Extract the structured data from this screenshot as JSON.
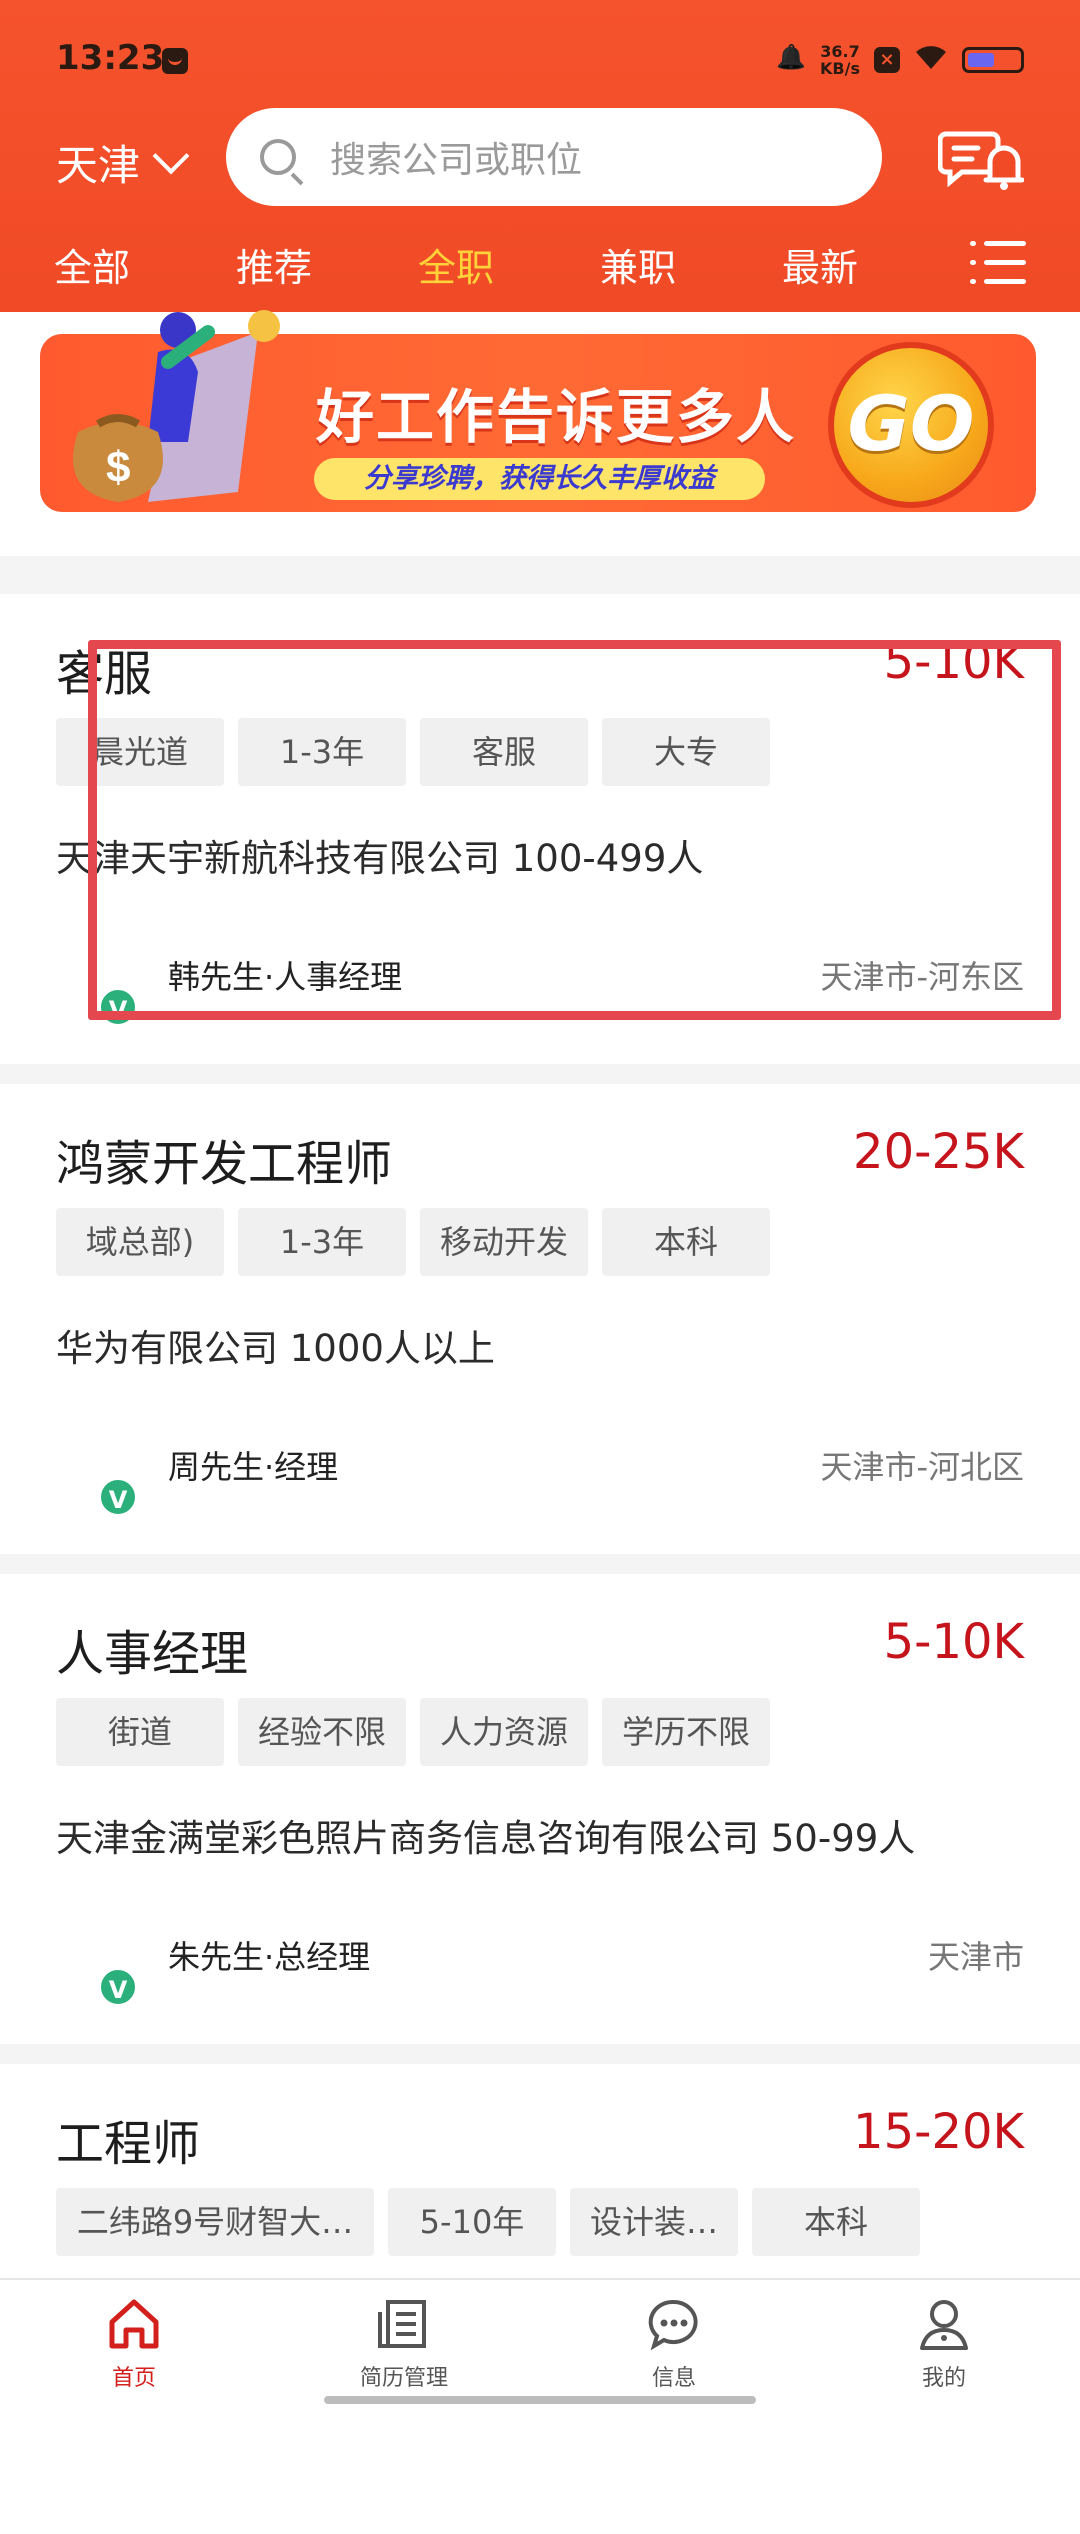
{
  "status": {
    "time": "13:23",
    "speed_value": "36.7",
    "speed_unit": "KB/s"
  },
  "header": {
    "city": "天津",
    "search_placeholder": "搜索公司或职位"
  },
  "tabs": [
    {
      "label": "全部",
      "active": false
    },
    {
      "label": "推荐",
      "active": false
    },
    {
      "label": "全职",
      "active": true
    },
    {
      "label": "兼职",
      "active": false
    },
    {
      "label": "最新",
      "active": false
    }
  ],
  "banner": {
    "title": "好工作告诉更多人",
    "subtitle": "分享珍聘，获得长久丰厚收益",
    "go": "GO"
  },
  "jobs": [
    {
      "title": "客服",
      "salary": "5-10K",
      "tags": [
        "晨光道",
        "1-3年",
        "客服",
        "大专"
      ],
      "company": "天津天宇新航科技有限公司  100-499人",
      "recruiter": "韩先生·人事经理",
      "location": "天津市-河东区"
    },
    {
      "title": "鸿蒙开发工程师",
      "salary": "20-25K",
      "tags": [
        "域总部)",
        "1-3年",
        "移动开发",
        "本科"
      ],
      "company": "华为有限公司  1000人以上",
      "recruiter": "周先生·经理",
      "location": "天津市-河北区"
    },
    {
      "title": "人事经理",
      "salary": "5-10K",
      "tags": [
        "街道",
        "经验不限",
        "人力资源",
        "学历不限"
      ],
      "company": "天津金满堂彩色照片商务信息咨询有限公司  50-99人",
      "recruiter": "朱先生·总经理",
      "location": "天津市"
    },
    {
      "title": "工程师",
      "salary": "15-20K",
      "tags": [
        "二纬路9号财智大…",
        "5-10年",
        "设计装…",
        "本科"
      ]
    }
  ],
  "verified_badge": "V",
  "bottom_nav": [
    {
      "label": "首页",
      "active": true
    },
    {
      "label": "简历管理",
      "active": false
    },
    {
      "label": "信息",
      "active": false
    },
    {
      "label": "我的",
      "active": false
    }
  ],
  "colors": {
    "brand": "#f04a26",
    "salary": "#c5141c",
    "active_tab": "#ffd23a",
    "verified": "#2bb07b",
    "highlight": "#e4474d"
  }
}
